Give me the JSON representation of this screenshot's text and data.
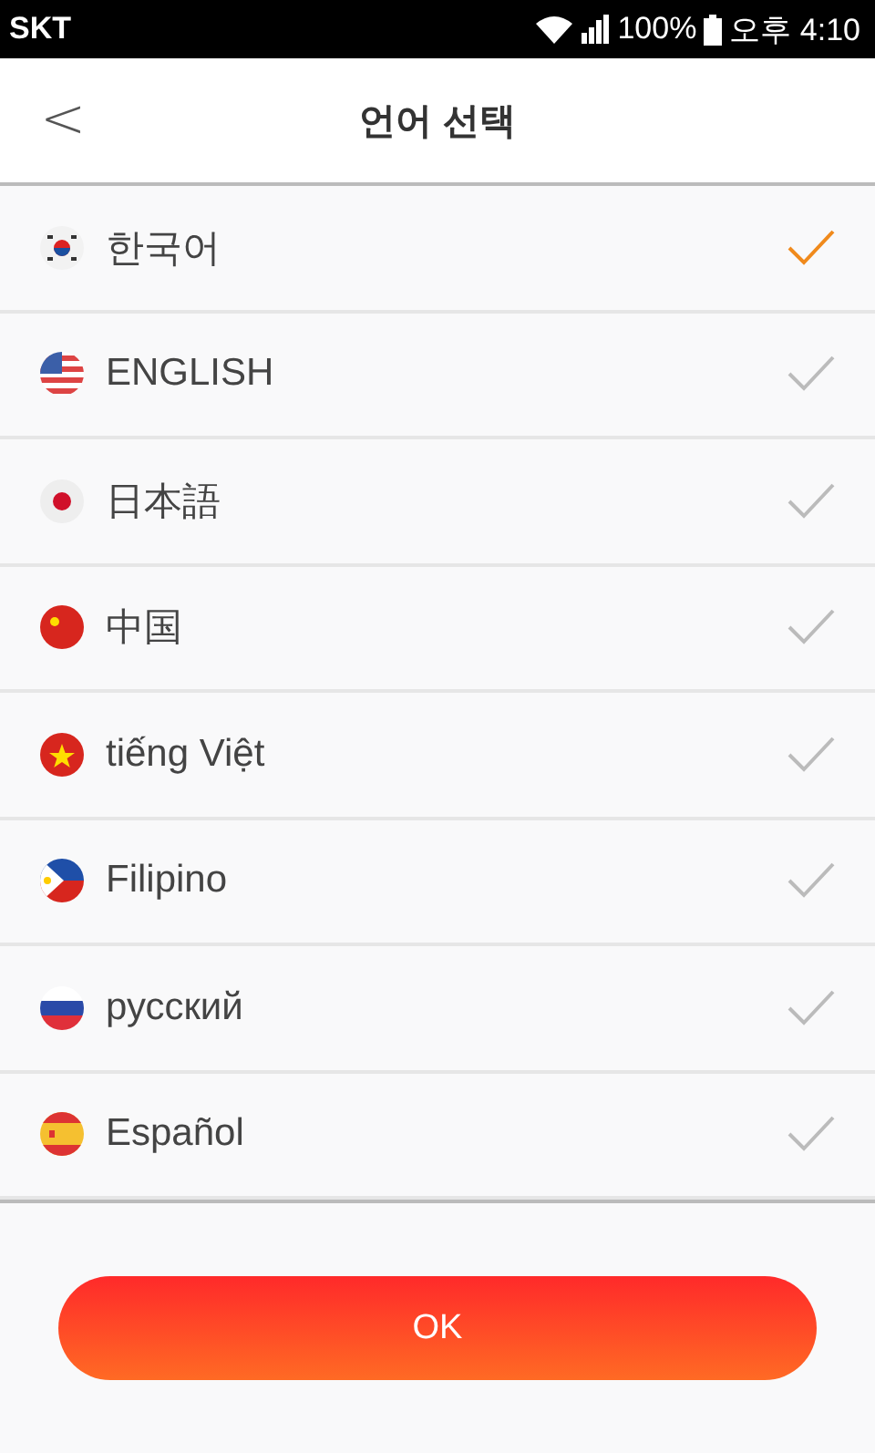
{
  "status_bar": {
    "carrier": "SKT",
    "battery": "100%",
    "time": "오후 4:10"
  },
  "header": {
    "back": "<",
    "title": "언어 선택"
  },
  "languages": [
    {
      "label": "한국어",
      "selected": true
    },
    {
      "label": "ENGLISH",
      "selected": false
    },
    {
      "label": "日本語",
      "selected": false
    },
    {
      "label": "中国",
      "selected": false
    },
    {
      "label": "tiếng Việt",
      "selected": false
    },
    {
      "label": "Filipino",
      "selected": false
    },
    {
      "label": "русский",
      "selected": false
    },
    {
      "label": "Español",
      "selected": false
    }
  ],
  "ok_button": "OK"
}
